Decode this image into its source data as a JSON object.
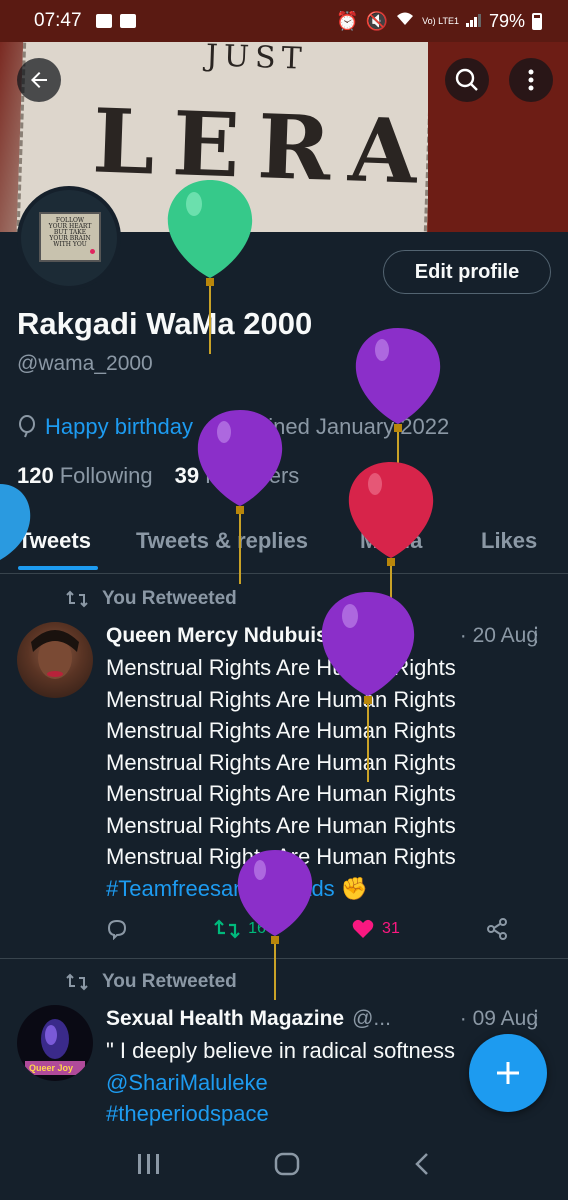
{
  "status_bar": {
    "time": "07:47",
    "network": "Vo) LTE1",
    "battery": "79%"
  },
  "banner": {
    "sign_top": "JUST",
    "sign_main": "LERATO"
  },
  "avatar_text": [
    "FOLLOW",
    "YOUR HEART",
    "BUT TAKE",
    "YOUR BRAIN",
    "WITH YOU"
  ],
  "profile": {
    "edit_label": "Edit profile",
    "name": "Rakgadi WaMa 2000",
    "handle": "@wama_2000",
    "birthday_text": "Happy birthday",
    "joined_text": "Joined January 2022",
    "following_count": "120",
    "following_label": "Following",
    "followers_count": "39",
    "followers_label": "Followers"
  },
  "tabs": [
    "Tweets",
    "Tweets & replies",
    "Media",
    "Likes"
  ],
  "tweets": [
    {
      "retweet_label": "You Retweeted",
      "author": "Queen Mercy Ndubuisi",
      "handle": "@m...",
      "date": "· 20 Aug",
      "lines": [
        "Menstrual Rights Are Human Rights",
        "Menstrual Rights Are Human Rights",
        "Menstrual Rights Are Human Rights",
        "Menstrual Rights Are Human Rights",
        "Menstrual Rights Are Human Rights",
        "Menstrual Rights Are Human Rights",
        "Menstrual Rights Are Human Rights"
      ],
      "hashtag": "#Teamfreesanitarypads",
      "emoji": "✊",
      "retweets": "16",
      "likes": "31"
    },
    {
      "retweet_label": "You Retweeted",
      "author": "Sexual Health Magazine",
      "handle": "@...",
      "date": "· 09 Aug",
      "line1": "\" I deeply believe in radical softness",
      "mention": "@ShariMaluleke",
      "hashtag": "#theperiodspace",
      "avatar_text": "Queer Joy"
    }
  ],
  "colors": {
    "background": "#15202b",
    "accent": "#1d9bf0",
    "retweet": "#00ba7c",
    "like": "#f91880"
  }
}
